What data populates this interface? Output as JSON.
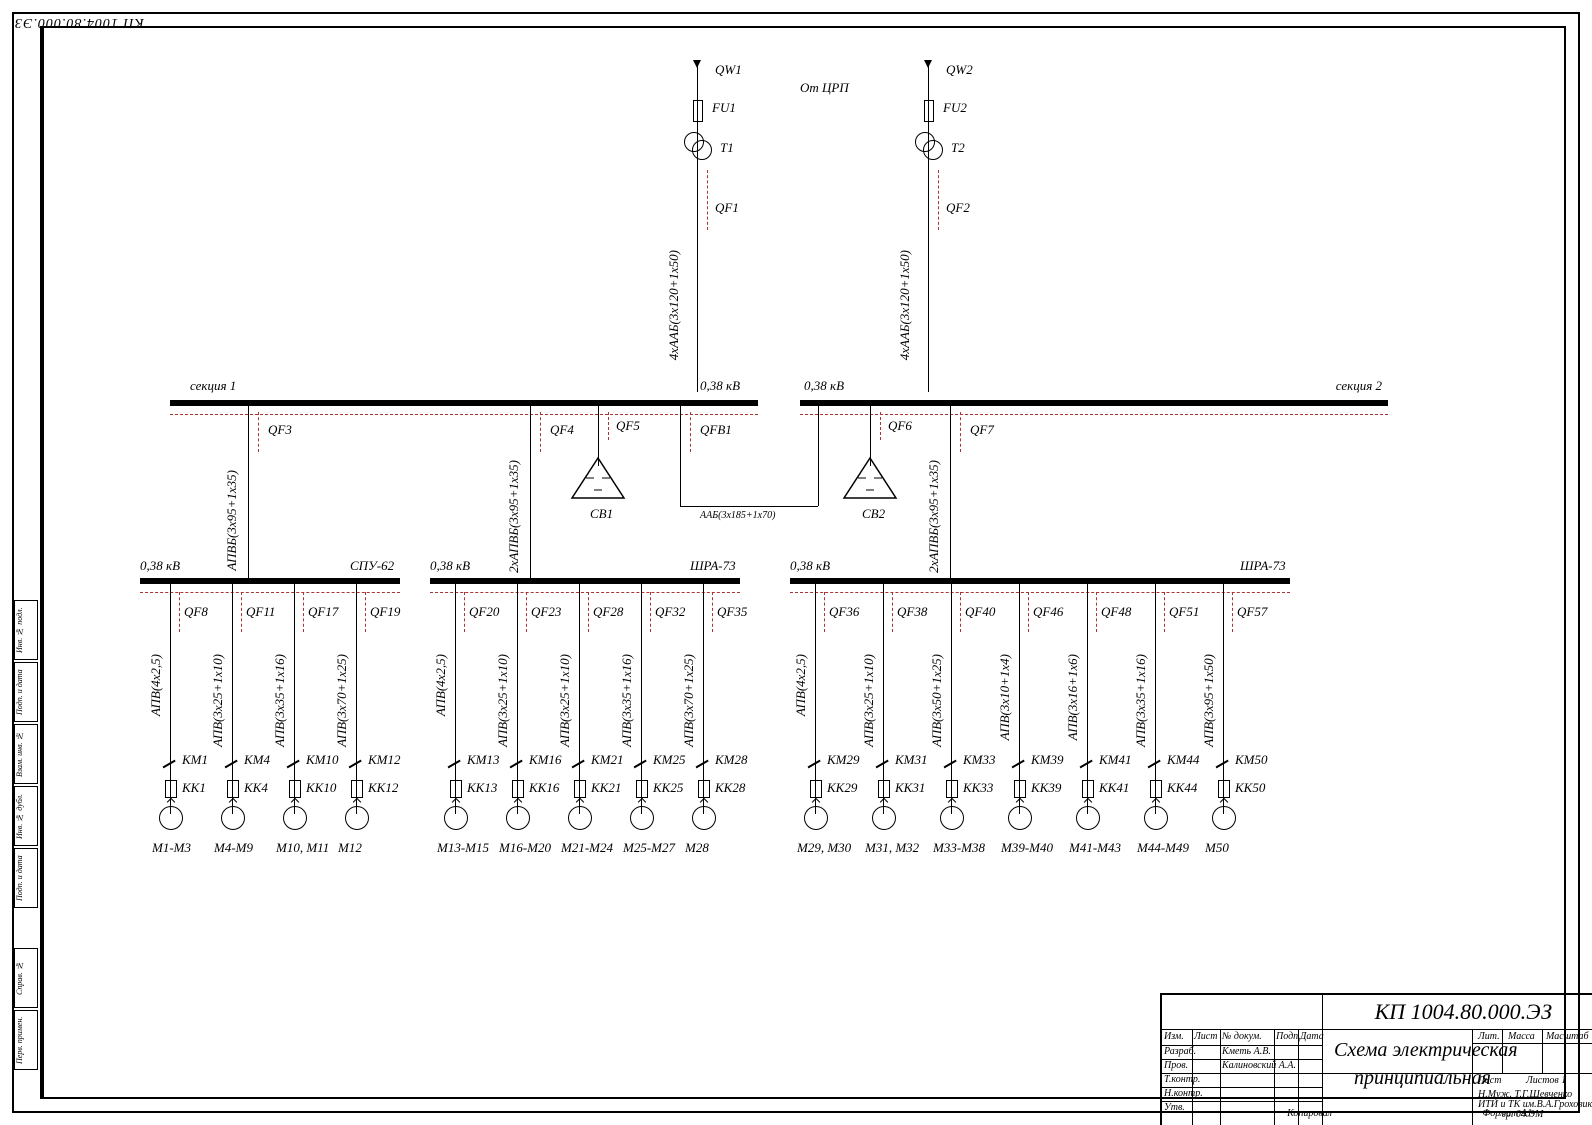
{
  "document_code": "КП 1004.80.000.ЭЗ",
  "title_block": {
    "code": "КП 1004.80.000.ЭЗ",
    "title_line1": "Схема электрическая",
    "title_line2": "принципиальная",
    "cols": [
      "Лит.",
      "Масса",
      "Масштаб"
    ],
    "rows": {
      "izm": "Изм.",
      "list": "Лист",
      "ndokum": "№ докум.",
      "podp": "Подп.",
      "data": "Дата",
      "razrab": "Разраб.",
      "razrab_name": "Кметь А.В.",
      "prov": "Пров.",
      "prov_name": "Калиновский А.А.",
      "tkontr": "Т.контр.",
      "nkontr": "Н.контр.",
      "utv": "Утв.",
      "sheet": "Лист",
      "sheets": "Листов 1",
      "org1": "Н.Муж. Т.Г.Шевченко",
      "org2": "ИТИ и ТК им.В.А.Гроховика",
      "org3": "гр. 04.ЭМ",
      "kopiroval": "Копировал",
      "format": "Формат   А1"
    }
  },
  "left_margin": [
    "Инв. № подл.",
    "Подп. и дата",
    "Взам. инв. №",
    "Инв. № дубл.",
    "Подп. и дата",
    "Справ. №",
    "Перв. примен."
  ],
  "source": {
    "from": "От ЦРП",
    "qw1": "QW1",
    "qw2": "QW2",
    "fu1": "FU1",
    "fu2": "FU2",
    "t1": "T1",
    "t2": "T2",
    "qf1": "QF1",
    "qf2": "QF2",
    "feed_cable": "4хААБ(3х120+1х50)"
  },
  "sections": {
    "s1": {
      "label": "секция 1",
      "volt": "0,38 кВ"
    },
    "s2": {
      "label": "секция 2",
      "volt": "0,38 кВ"
    },
    "tie_cable": "ААБ(3х185+1х70)",
    "qfb1": "QFB1",
    "qf5": "QF5",
    "cb1": "CB1",
    "qf6": "QF6",
    "cb2": "CB2",
    "risers": {
      "qf3": "QF3",
      "qf4": "QF4",
      "qf7": "QF7",
      "riser_cable13": "АПВБ(3х95+1х35)",
      "riser_cable4": "2хАПВБ(3х95+1х35)",
      "riser_cable7": "2хАПВБ(3х95+1х35)"
    }
  },
  "sub_buses": {
    "a": {
      "volt": "0,38 кВ",
      "name": "СПУ-62"
    },
    "b": {
      "volt": "0,38 кВ",
      "name": "ШРА-73"
    },
    "c": {
      "volt": "0,38 кВ",
      "name": "ШРА-73"
    }
  },
  "branches": [
    {
      "bus": "a",
      "qf": "QF8",
      "cable": "АПВ(4х2,5)",
      "km": "KM1",
      "kk": "KK1",
      "motor": "M1-M3"
    },
    {
      "bus": "a",
      "qf": "QF11",
      "cable": "АПВ(3х25+1х10)",
      "km": "KM4",
      "kk": "KK4",
      "motor": "M4-M9"
    },
    {
      "bus": "a",
      "qf": "QF17",
      "cable": "АПВ(3х35+1х16)",
      "km": "KM10",
      "kk": "KK10",
      "motor": "M10, M11"
    },
    {
      "bus": "a",
      "qf": "QF19",
      "cable": "АПВ(3х70+1х25)",
      "km": "KM12",
      "kk": "KK12",
      "motor": "M12"
    },
    {
      "bus": "b",
      "qf": "QF20",
      "cable": "АПВ(4х2,5)",
      "km": "KM13",
      "kk": "KK13",
      "motor": "M13-M15"
    },
    {
      "bus": "b",
      "qf": "QF23",
      "cable": "АПВ(3х25+1х10)",
      "km": "KM16",
      "kk": "KK16",
      "motor": "M16-M20"
    },
    {
      "bus": "b",
      "qf": "QF28",
      "cable": "АПВ(3х25+1х10)",
      "km": "KM21",
      "kk": "KK21",
      "motor": "M21-M24"
    },
    {
      "bus": "b",
      "qf": "QF32",
      "cable": "АПВ(3х35+1х16)",
      "km": "KM25",
      "kk": "KK25",
      "motor": "M25-M27"
    },
    {
      "bus": "b",
      "qf": "QF35",
      "cable": "АПВ(3х70+1х25)",
      "km": "KM28",
      "kk": "KK28",
      "motor": "M28"
    },
    {
      "bus": "c",
      "qf": "QF36",
      "cable": "АПВ(4х2,5)",
      "km": "KM29",
      "kk": "KK29",
      "motor": "M29, M30"
    },
    {
      "bus": "c",
      "qf": "QF38",
      "cable": "АПВ(3х25+1х10)",
      "km": "KM31",
      "kk": "KK31",
      "motor": "M31, M32"
    },
    {
      "bus": "c",
      "qf": "QF40",
      "cable": "АПВ(3х50+1х25)",
      "km": "KM33",
      "kk": "KK33",
      "motor": "M33-M38"
    },
    {
      "bus": "c",
      "qf": "QF46",
      "cable": "АПВ(3х10+1х4)",
      "km": "KM39",
      "kk": "KK39",
      "motor": "M39-M40"
    },
    {
      "bus": "c",
      "qf": "QF48",
      "cable": "АПВ(3х16+1х6)",
      "km": "KM41",
      "kk": "KK41",
      "motor": "M41-M43"
    },
    {
      "bus": "c",
      "qf": "QF51",
      "cable": "АПВ(3х35+1х16)",
      "km": "KM44",
      "kk": "KK44",
      "motor": "M44-M49"
    },
    {
      "bus": "c",
      "qf": "QF57",
      "cable": "АПВ(3х95+1х50)",
      "km": "KM50",
      "kk": "KK50",
      "motor": "M50"
    }
  ]
}
